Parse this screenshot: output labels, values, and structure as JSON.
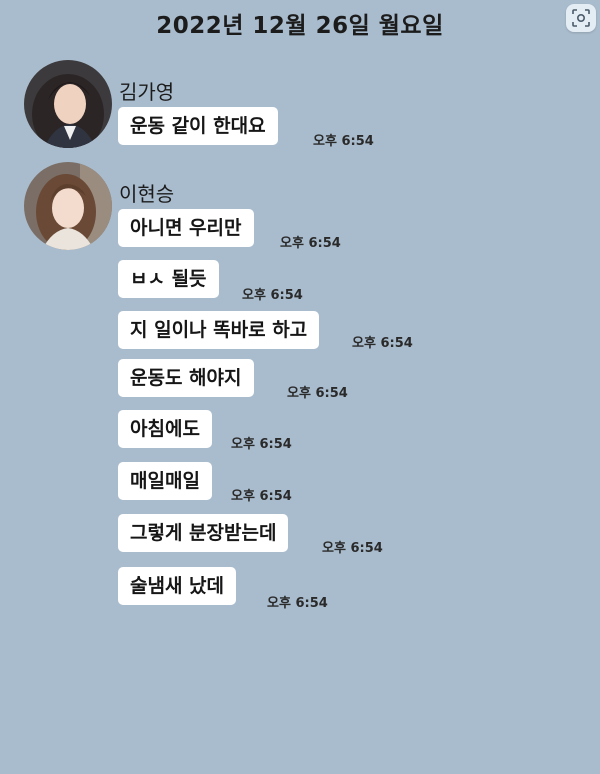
{
  "chat": {
    "date": "2022년 12월 26일 월요일"
  },
  "toolbar": {
    "scan_icon": "scan-text-icon"
  },
  "messages": [
    {
      "sender": "김가영",
      "avatar": "profile-photo",
      "items": [
        {
          "text": "운동 같이 한대요",
          "time": "오후 6:54"
        }
      ]
    },
    {
      "sender": "이현승",
      "avatar": "profile-photo",
      "items": [
        {
          "text": "아니면 우리만",
          "time": "오후 6:54"
        },
        {
          "text": "ㅂㅅ 될듯",
          "time": "오후 6:54"
        },
        {
          "text": "지 일이나 똑바로 하고",
          "time": "오후 6:54"
        },
        {
          "text": "운동도 해야지",
          "time": "오후 6:54"
        },
        {
          "text": "아침에도",
          "time": "오후 6:54"
        },
        {
          "text": "매일매일",
          "time": "오후 6:54"
        },
        {
          "text": "그렇게 분장받는데",
          "time": "오후 6:54"
        },
        {
          "text": "술냄새 났데",
          "time": "오후 6:54"
        }
      ]
    }
  ],
  "colors": {
    "background": "#a9bccd",
    "bubble": "#ffffff"
  }
}
